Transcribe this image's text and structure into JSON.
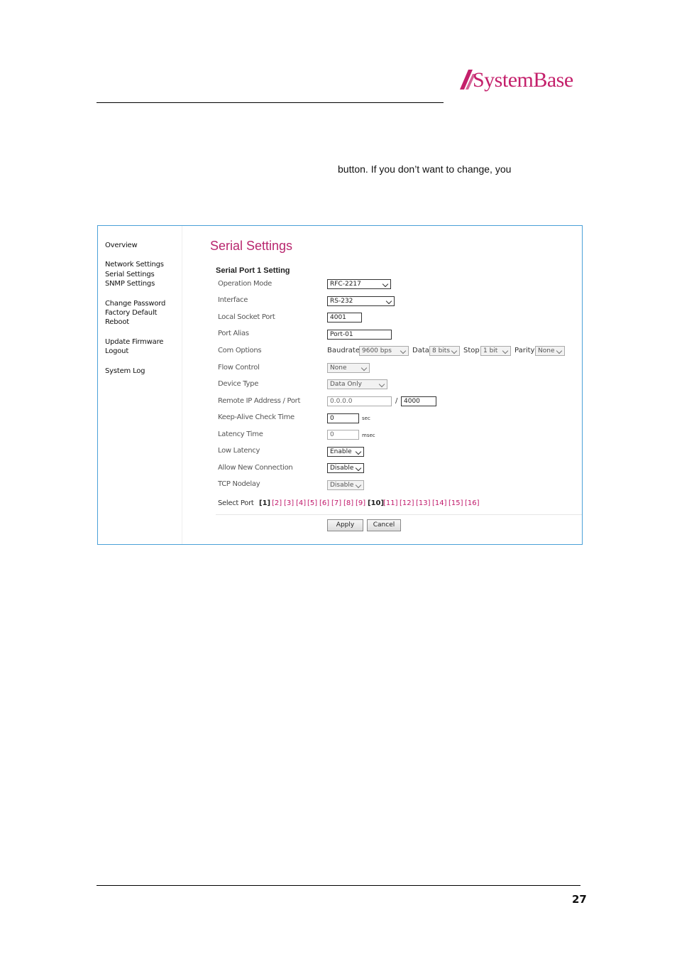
{
  "header": {
    "brand": "SystemBase",
    "brand_color": "#c4206b"
  },
  "intro_text": "button. If you don’t want to change, you",
  "sidebar": {
    "items": [
      {
        "label": "Overview"
      },
      {
        "label": "Network Settings"
      },
      {
        "label": "Serial Settings"
      },
      {
        "label": "SNMP Settings"
      },
      {
        "label": "Change Password"
      },
      {
        "label": "Factory Default"
      },
      {
        "label": "Reboot"
      },
      {
        "label": "Update Firmware"
      },
      {
        "label": "Logout"
      },
      {
        "label": "System Log"
      }
    ]
  },
  "main": {
    "title": "Serial Settings",
    "section_title": "Serial Port 1 Setting",
    "fields": {
      "operation_mode": {
        "label": "Operation Mode",
        "value": "RFC-2217"
      },
      "interface": {
        "label": "Interface",
        "value": "RS-232"
      },
      "local_socket_port": {
        "label": "Local Socket Port",
        "value": "4001"
      },
      "port_alias": {
        "label": "Port Alias",
        "value": "Port-01"
      },
      "com_options": {
        "label": "Com Options",
        "baudrate_label": "Baudrate",
        "baudrate": "9600 bps",
        "data_label": "Data",
        "data": "8 bits",
        "stop_label": "Stop",
        "stop": "1 bit",
        "parity_label": "Parity",
        "parity": "None"
      },
      "flow_control": {
        "label": "Flow Control",
        "value": "None"
      },
      "device_type": {
        "label": "Device Type",
        "value": "Data Only"
      },
      "remote_ip": {
        "label": "Remote IP Address / Port",
        "ip": "0.0.0.0",
        "separator": "/",
        "port": "4000"
      },
      "keepalive": {
        "label": "Keep-Alive Check Time",
        "value": "0",
        "unit": "sec"
      },
      "latency_time": {
        "label": "Latency Time",
        "value": "0",
        "unit": "msec"
      },
      "low_latency": {
        "label": "Low Latency",
        "value": "Enable"
      },
      "allow_new_connection": {
        "label": "Allow New Connection",
        "value": "Disable"
      },
      "tcp_nodelay": {
        "label": "TCP Nodelay",
        "value": "Disable"
      }
    },
    "select_port": {
      "label": "Select Port",
      "ports": [
        "[1]",
        "[2]",
        "[3]",
        "[4]",
        "[5]",
        "[6]",
        "[7]",
        "[8]",
        "[9]",
        "[10]",
        "[11]",
        "[12]",
        "[13]",
        "[14]",
        "[15]",
        "[16]"
      ]
    },
    "buttons": {
      "apply": "Apply",
      "cancel": "Cancel"
    }
  },
  "footer": {
    "page_number": "27"
  }
}
